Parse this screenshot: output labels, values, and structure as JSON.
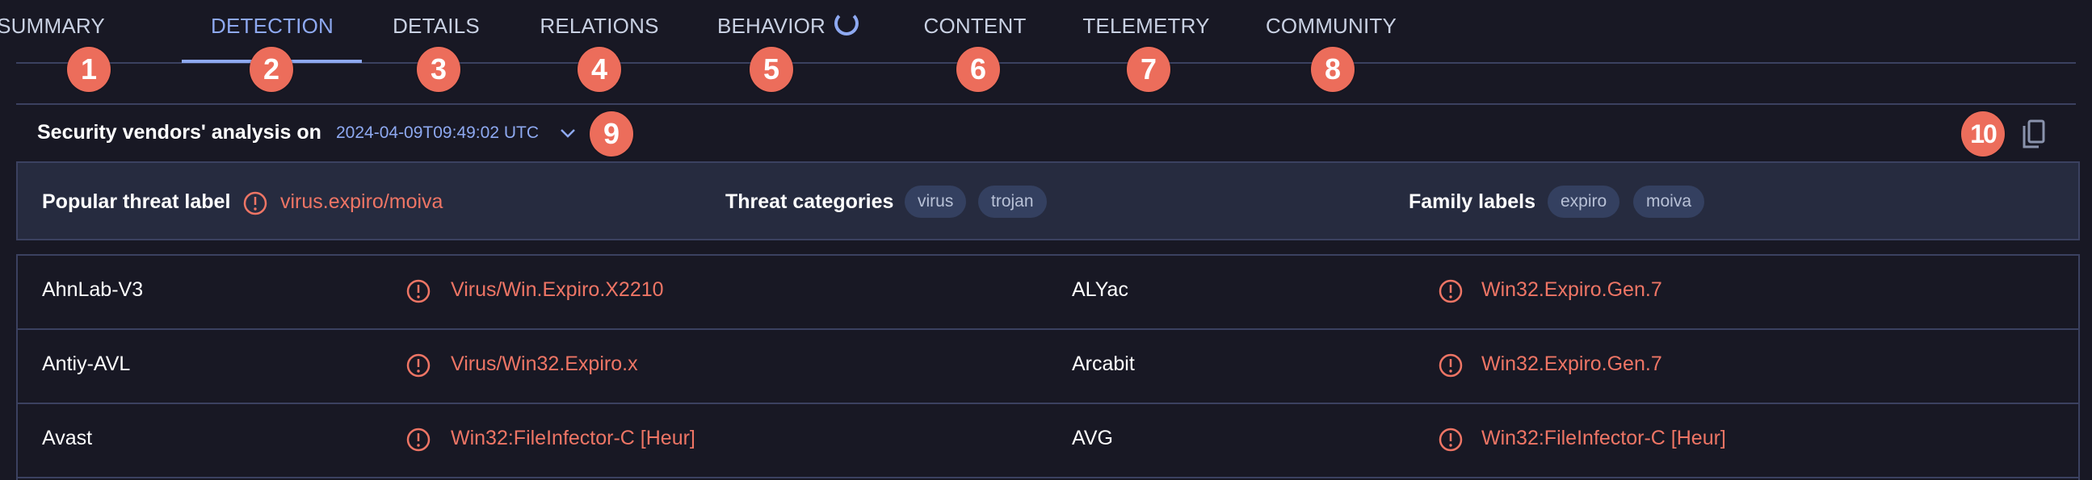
{
  "tabs": [
    {
      "label": "SUMMARY",
      "active": false
    },
    {
      "label": "DETECTION",
      "active": true
    },
    {
      "label": "DETAILS",
      "active": false
    },
    {
      "label": "RELATIONS",
      "active": false
    },
    {
      "label": "BEHAVIOR",
      "active": false,
      "loading": true
    },
    {
      "label": "CONTENT",
      "active": false
    },
    {
      "label": "TELEMETRY",
      "active": false
    },
    {
      "label": "COMMUNITY",
      "active": false
    }
  ],
  "annotations": [
    "1",
    "2",
    "3",
    "4",
    "5",
    "6",
    "7",
    "8",
    "9",
    "10"
  ],
  "analysis": {
    "title": "Security vendors' analysis on",
    "timestamp": "2024-04-09T09:49:02 UTC",
    "expand_icon": "chevron-down-icon",
    "copy_icon": "copy-icon"
  },
  "summary": {
    "popular_threat_label": {
      "label": "Popular threat label",
      "value": "virus.expiro/moiva"
    },
    "threat_categories": {
      "label": "Threat categories",
      "values": [
        "virus",
        "trojan"
      ]
    },
    "family_labels": {
      "label": "Family labels",
      "values": [
        "expiro",
        "moiva"
      ]
    }
  },
  "detections": [
    {
      "left": {
        "vendor": "AhnLab-V3",
        "result": "Virus/Win.Expiro.X2210"
      },
      "right": {
        "vendor": "ALYac",
        "result": "Win32.Expiro.Gen.7"
      }
    },
    {
      "left": {
        "vendor": "Antiy-AVL",
        "result": "Virus/Win32.Expiro.x"
      },
      "right": {
        "vendor": "Arcabit",
        "result": "Win32.Expiro.Gen.7"
      }
    },
    {
      "left": {
        "vendor": "Avast",
        "result": "Win32:FileInfector-C [Heur]"
      },
      "right": {
        "vendor": "AVG",
        "result": "Win32:FileInfector-C [Heur]"
      }
    }
  ],
  "colors": {
    "accent": "#8ea9f1",
    "malicious": "#ee7565",
    "badge": "#ec6d5b",
    "background": "#181824",
    "panel": "#262b3f"
  }
}
